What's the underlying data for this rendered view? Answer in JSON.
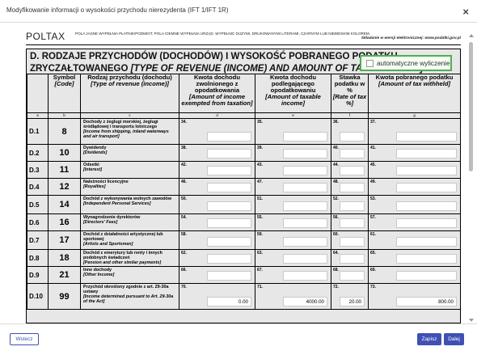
{
  "window": {
    "title": "Modyfikowanie informacji o wysokości przychodu nierezydenta (IFT 1/IFT 1R)",
    "close_label": "×"
  },
  "form": {
    "logo": "POLTAX",
    "instructions": "POLA JASNE WYPEŁNIA PŁATNIK/PODMIOT. POLA CIEMNE WYPEŁNIA URZĄD. WYPEŁNIĆ DUŻYMI, DRUKOWANYMI LITERAMI, CZARNYM LUB NIEBIESKIM KOLOREM.",
    "version_note": "Składanie w wersji elektronicznej: www.podatki.gov.pl"
  },
  "section": {
    "title_pl": "D. RODZAJE PRZYCHODÓW (DOCHODÓW) I WYSOKOŚĆ POBRANEGO PODATKU ZRYCZAŁTOWANEGO",
    "title_en": "[TYPE OF REVENUE (INCOME) AND AMOUNT OF TAX WITHHELD]",
    "title_sup": "4)"
  },
  "auto_calc": {
    "label": "automatyczne wyliczenie",
    "checked": false,
    "accent": "#4caf50"
  },
  "table": {
    "headers": [
      {
        "pl": "",
        "en": ""
      },
      {
        "pl": "Symbol",
        "en": "[Code]"
      },
      {
        "pl": "Rodzaj przychodu (dochodu)",
        "en": "[Type of revenue (income)]"
      },
      {
        "pl": "Kwota dochodu zwolnionego z opodatkowania",
        "en": "[Amount of income exempted from taxation]"
      },
      {
        "pl": "Kwota dochodu podlegającego opodatkowaniu",
        "en": "[Amount of taxable income]"
      },
      {
        "pl": "Stawka podatku w %",
        "en": "[Rate of tax %]"
      },
      {
        "pl": "Kwota pobranego podatku",
        "en": "[Amount of tax withheld]"
      }
    ],
    "letters": [
      "a",
      "b",
      "c",
      "d",
      "e",
      "f",
      "g"
    ],
    "rows": [
      {
        "id": "D.1",
        "symbol": "8",
        "desc_pl": "Dochody z żeglugi morskiej, żeglugi śródlądowej i transportu lotniczego",
        "desc_en": "[Income from shipping, inland waterways and air transport]",
        "fields": [
          {
            "num": "34.",
            "value": ""
          },
          {
            "num": "35.",
            "value": ""
          },
          {
            "num": "36.",
            "value": ""
          },
          {
            "num": "37.",
            "value": ""
          }
        ]
      },
      {
        "id": "D.2",
        "symbol": "10",
        "desc_pl": "Dywidendy",
        "desc_en": "[Dividends]",
        "fields": [
          {
            "num": "38.",
            "value": ""
          },
          {
            "num": "39.",
            "value": ""
          },
          {
            "num": "40.",
            "value": ""
          },
          {
            "num": "41.",
            "value": ""
          }
        ]
      },
      {
        "id": "D.3",
        "symbol": "11",
        "desc_pl": "Odsetki",
        "desc_en": "[Interest]",
        "fields": [
          {
            "num": "42.",
            "value": ""
          },
          {
            "num": "43.",
            "value": ""
          },
          {
            "num": "44.",
            "value": ""
          },
          {
            "num": "45.",
            "value": ""
          }
        ]
      },
      {
        "id": "D.4",
        "symbol": "12",
        "desc_pl": "Należności licencyjne",
        "desc_en": "[Royalties]",
        "fields": [
          {
            "num": "46.",
            "value": ""
          },
          {
            "num": "47.",
            "value": ""
          },
          {
            "num": "48.",
            "value": ""
          },
          {
            "num": "49.",
            "value": ""
          }
        ]
      },
      {
        "id": "D.5",
        "symbol": "14",
        "desc_pl": "Dochód z wykonywania wolnych zawodów",
        "desc_en": "[Independent Personal Services]",
        "fields": [
          {
            "num": "50.",
            "value": ""
          },
          {
            "num": "51.",
            "value": ""
          },
          {
            "num": "52.",
            "value": ""
          },
          {
            "num": "53.",
            "value": ""
          }
        ]
      },
      {
        "id": "D.6",
        "symbol": "16",
        "desc_pl": "Wynagrodzenie dyrektorów",
        "desc_en": "[Directors' Fees]",
        "fields": [
          {
            "num": "54.",
            "value": ""
          },
          {
            "num": "55.",
            "value": ""
          },
          {
            "num": "56.",
            "value": ""
          },
          {
            "num": "57.",
            "value": ""
          }
        ]
      },
      {
        "id": "D.7",
        "symbol": "17",
        "desc_pl": "Dochód z działalności artystycznej lub sportowej",
        "desc_en": "[Artists and Sportsmen]",
        "fields": [
          {
            "num": "58.",
            "value": ""
          },
          {
            "num": "59.",
            "value": ""
          },
          {
            "num": "60.",
            "value": ""
          },
          {
            "num": "61.",
            "value": ""
          }
        ]
      },
      {
        "id": "D.8",
        "symbol": "18",
        "desc_pl": "Dochód z emerytury lub renty i innych podobnych świadczeń",
        "desc_en": "[Pension and other similar payments]",
        "fields": [
          {
            "num": "62.",
            "value": ""
          },
          {
            "num": "63.",
            "value": ""
          },
          {
            "num": "64.",
            "value": ""
          },
          {
            "num": "65.",
            "value": ""
          }
        ]
      },
      {
        "id": "D.9",
        "symbol": "21",
        "desc_pl": "Inne dochody",
        "desc_en": "[Other Income]",
        "fields": [
          {
            "num": "66.",
            "value": ""
          },
          {
            "num": "67.",
            "value": ""
          },
          {
            "num": "68.",
            "value": ""
          },
          {
            "num": "69.",
            "value": ""
          }
        ]
      },
      {
        "id": "D.10",
        "symbol": "99",
        "desc_pl": "Przychód określony zgodnie z art. 29-30a ustawy",
        "desc_en": "[Income determined pursuant to Art. 29-30a of the Act]",
        "fields": [
          {
            "num": "70.",
            "value": "0.00"
          },
          {
            "num": "71.",
            "value": "4000.00"
          },
          {
            "num": "72.",
            "value": "20.00"
          },
          {
            "num": "73.",
            "value": "800.00"
          }
        ]
      }
    ]
  },
  "footer": {
    "back_label": "Wstecz",
    "save_label": "Zapisz",
    "next_label": "Dalej",
    "accent": "#3f51b5"
  }
}
